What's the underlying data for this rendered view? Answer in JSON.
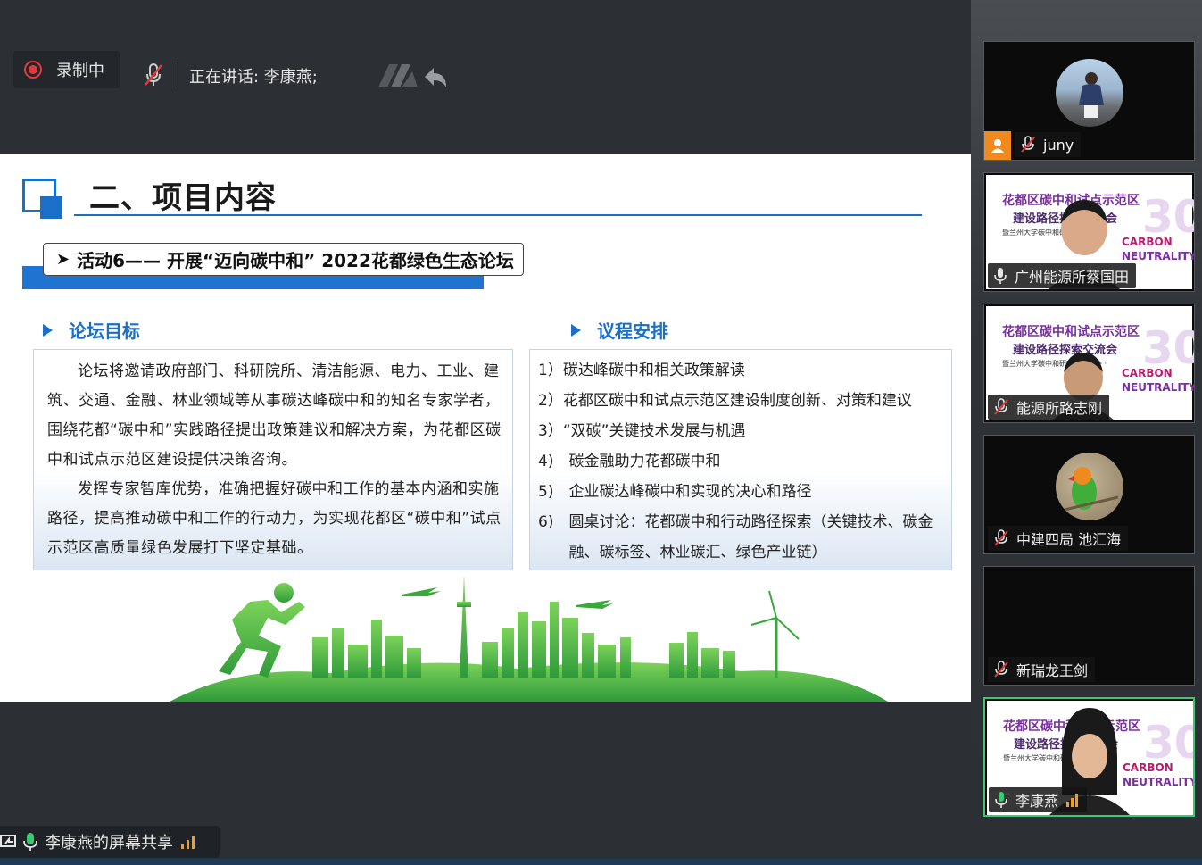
{
  "topbar": {
    "recording_label": "录制中",
    "speaking_label": "正在讲话: 李康燕;"
  },
  "slide": {
    "title": "二、项目内容",
    "activity": "活动6—— 开展“迈向碳中和” 2022花都绿色生态论坛",
    "left_heading": "论坛目标",
    "left_paragraphs": [
      "论坛将邀请政府部门、科研院所、清洁能源、电力、工业、建筑、交通、金融、林业领域等从事碳达峰碳中和的知名专家学者，围绕花都“碳中和”实践路径提出政策建议和解决方案，为花都区碳中和试点示范区建设提供决策咨询。",
      "发挥专家智库优势，准确把握好碳中和工作的基本内涵和实施路径，提高推动碳中和工作的行动力，为实现花都区“碳中和”试点示范区高质量绿色发展打下坚定基础。"
    ],
    "right_heading": "议程安排",
    "agenda": [
      {
        "num": "1）",
        "text": "碳达峰碳中和相关政策解读"
      },
      {
        "num": "2）",
        "text": "花都区碳中和试点示范区建设制度创新、对策和建议"
      },
      {
        "num": "3）",
        "text": "“双碳”关键技术发展与机遇"
      },
      {
        "num": "4)　",
        "text": "碳金融助力花都碳中和"
      },
      {
        "num": "5)　",
        "text": "企业碳达峰碳中和实现的决心和路径"
      },
      {
        "num": "6)　",
        "text": "圆桌讨论：花都碳中和行动路径探索（关键技术、碳金融、碳标签、林业碳汇、绿色产业链）"
      }
    ]
  },
  "share_bar": {
    "label": "李康燕的屏幕共享"
  },
  "participants": [
    {
      "name": "juny",
      "muted": true
    },
    {
      "name": "广州能源所蔡国田",
      "muted": false
    },
    {
      "name": "能源所路志刚",
      "muted": true
    },
    {
      "name": "中建四局 池汇海",
      "muted": true
    },
    {
      "name": "新瑞龙王剑",
      "muted": true
    },
    {
      "name": "李康燕",
      "muted": false
    }
  ],
  "poster": {
    "line1": "花都区碳中和试点示范区",
    "line2": "建设路径探索交流会",
    "line3": "暨兰州大学碳中和研究所推进会 ·",
    "carbon": "CARBON",
    "neutrality": "NEUTRALITY",
    "big": "30"
  },
  "colors": {
    "accent_blue": "#1a6fc7",
    "active_speaker": "#3cc873",
    "record_red": "#e03a3a",
    "skyline_green": "#3aa83a"
  }
}
